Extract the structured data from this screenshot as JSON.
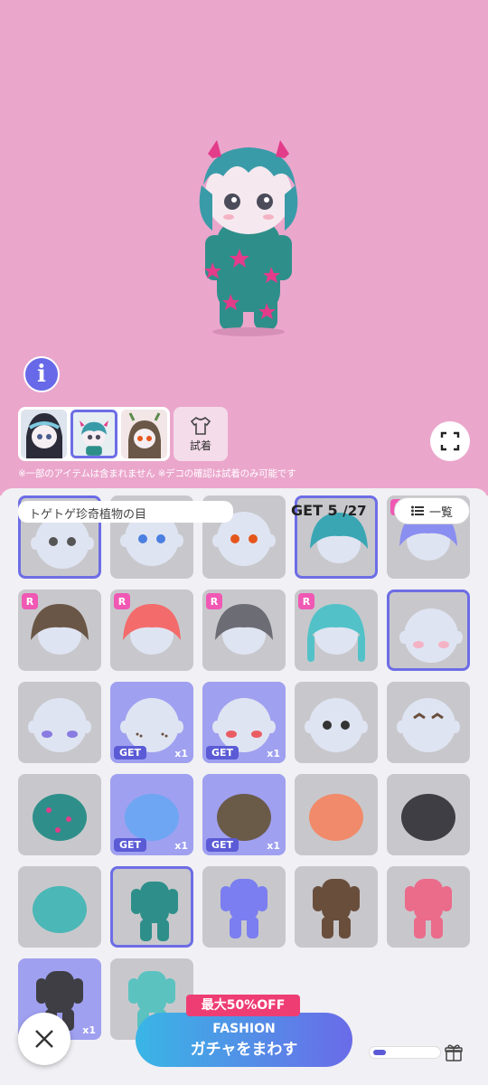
{
  "preview": {
    "info_label": "i",
    "try_on_label": "試着",
    "note": "※一部のアイテムは含まれません ※デコの確認は試着のみ可能です"
  },
  "panel": {
    "title": "トゲトゲ珍奇植物の目",
    "get_prefix": "GET ",
    "get_count": "5",
    "get_total": "/27",
    "list_label": "一覧"
  },
  "items": [
    {
      "kind": "face-eyes-grey",
      "sel": true
    },
    {
      "kind": "face-eyes-blue"
    },
    {
      "kind": "face-eyes-orange"
    },
    {
      "kind": "hair-teal",
      "sel": true
    },
    {
      "kind": "hair-purple",
      "rare": true
    },
    {
      "kind": "hood-brown",
      "rare": true
    },
    {
      "kind": "hair-rainbow",
      "rare": true
    },
    {
      "kind": "hair-zebra",
      "rare": true
    },
    {
      "kind": "hair-teal-braids",
      "rare": true
    },
    {
      "kind": "face-blush-pink",
      "sel": true
    },
    {
      "kind": "face-blush-purple"
    },
    {
      "kind": "face-freckles",
      "blue": true,
      "get": true,
      "count": "x1"
    },
    {
      "kind": "face-blush-red",
      "blue": true,
      "get": true,
      "count": "x1"
    },
    {
      "kind": "face-dark-eyes"
    },
    {
      "kind": "face-bat-brows"
    },
    {
      "kind": "cactus-ball"
    },
    {
      "kind": "plant-blue",
      "blue": true,
      "get": true,
      "count": "x1"
    },
    {
      "kind": "bag-brown",
      "blue": true,
      "get": true,
      "count": "x1"
    },
    {
      "kind": "plant-rainbow"
    },
    {
      "kind": "plant-zebra"
    },
    {
      "kind": "plant-teal"
    },
    {
      "kind": "suit-cactus",
      "sel": true
    },
    {
      "kind": "suit-purple"
    },
    {
      "kind": "suit-brown"
    },
    {
      "kind": "suit-rainbow"
    },
    {
      "kind": "suit-zebra",
      "blue": true,
      "count": "x1"
    },
    {
      "kind": "suit-teal"
    }
  ],
  "badges": {
    "rare": "R",
    "get": "GET"
  },
  "bottom": {
    "sale_label": "最大50%OFF",
    "gacha_line1": "FASHION",
    "gacha_line2": "ガチャをまわす",
    "progress_fraction": 0.2
  },
  "colors": {
    "accent": "#6d6de6",
    "background": "#eba6cc",
    "rare": "#f058b4",
    "sale": "#ee3d73"
  }
}
